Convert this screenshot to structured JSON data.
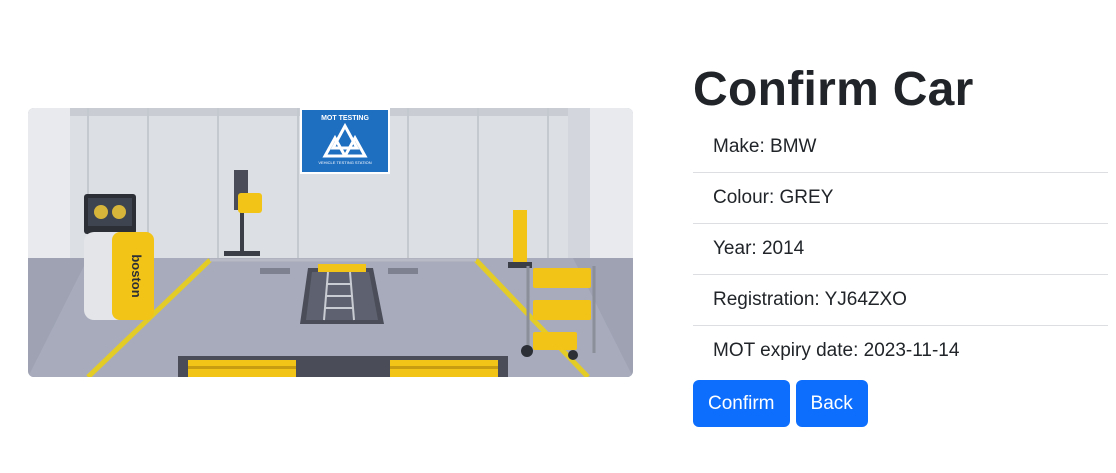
{
  "page": {
    "title": "Confirm Car"
  },
  "car": {
    "make": "Make: BMW",
    "colour": "Colour: GREY",
    "year": "Year: 2014",
    "registration": "Registration: YJ64ZXO",
    "mot_expiry": "MOT expiry date: 2023-11-14"
  },
  "actions": {
    "confirm_label": "Confirm",
    "back_label": "Back"
  },
  "illustration": {
    "sign_title": "MOT TESTING",
    "sign_subtitle": "VEHICLE TESTING STATION",
    "equipment_brand": "boston"
  },
  "colors": {
    "primary": "#0d6efd",
    "sign_blue": "#1f6fc1",
    "equipment_yellow": "#f2c418"
  }
}
